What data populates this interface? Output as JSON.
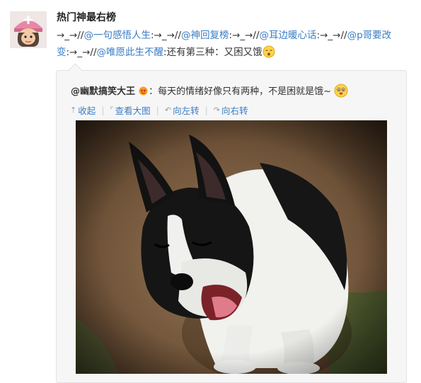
{
  "post": {
    "author": "热门神最右榜",
    "segments": [
      {
        "text": "→_→//",
        "mention": false
      },
      {
        "text": "@一句感悟人生",
        "mention": true
      },
      {
        "text": ":→_→//",
        "mention": false
      },
      {
        "text": "@神回复榜",
        "mention": true
      },
      {
        "text": ":→_→//",
        "mention": false
      },
      {
        "text": "@耳边暖心话",
        "mention": true
      },
      {
        "text": ":→_→//",
        "mention": false
      },
      {
        "text": "@p哥要改变",
        "mention": true
      },
      {
        "text": ":→_→//",
        "mention": false
      },
      {
        "text": "@唯愿此生不醒",
        "mention": true
      },
      {
        "text": ":还有第三种：又困又饿",
        "mention": false
      }
    ]
  },
  "repost": {
    "nick": "@幽默搞笑大王",
    "text": "：每天的情绪好像只有两种，不是困就是饿~"
  },
  "tools": {
    "collapse": "收起",
    "view_large": "查看大图",
    "rotate_left": "向左转",
    "rotate_right": "向右转"
  },
  "icons": {
    "collapse": "collapse-arrow-icon",
    "view_large": "zoom-image-icon",
    "rotate_left": "rotate-left-icon",
    "rotate_right": "rotate-right-icon",
    "sleepy_emoji": "sleepy-face-emoji",
    "vip": "vip-badge-icon",
    "hungry_emoji": "drooling-face-emoji"
  },
  "colors": {
    "link": "#3b7dc4",
    "repost_bg": "#f6f6f6",
    "repost_border": "#e3e3e3"
  }
}
